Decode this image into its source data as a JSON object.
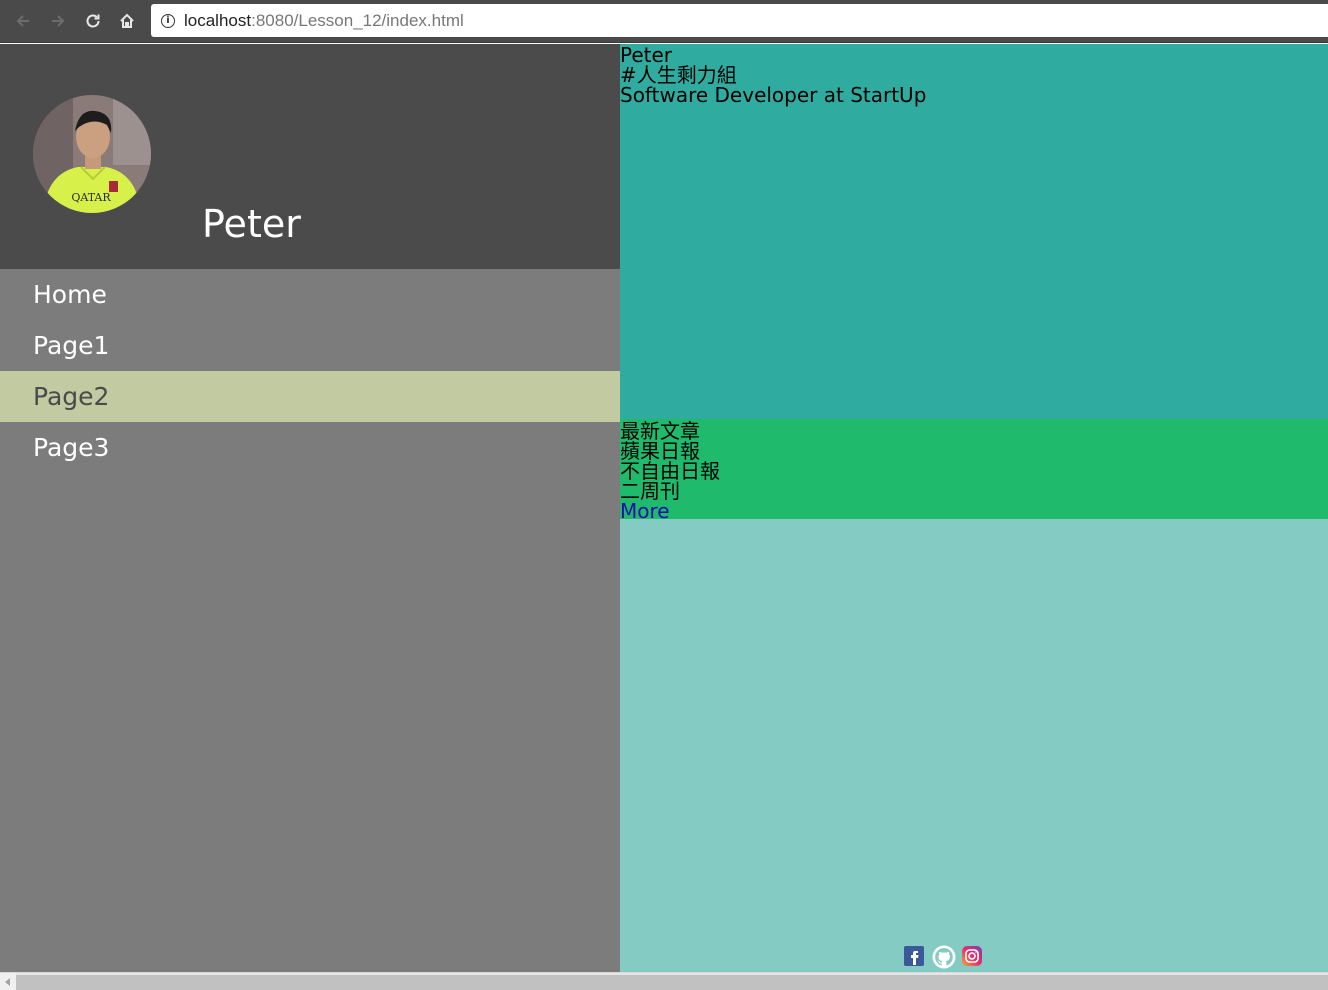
{
  "browser": {
    "url_host": "localhost",
    "url_path": ":8080/Lesson_12/index.html",
    "nav": {
      "back": "back-arrow",
      "forward": "forward-arrow",
      "reload": "reload",
      "home": "home"
    }
  },
  "sidebar": {
    "profile_name": "Peter",
    "menu": [
      {
        "label": "Home",
        "active": false
      },
      {
        "label": "Page1",
        "active": false
      },
      {
        "label": "Page2",
        "active": true
      },
      {
        "label": "Page3",
        "active": false
      }
    ]
  },
  "intro": {
    "name": "Peter",
    "tag": "#人生剩力組",
    "job": "Software Developer at StartUp"
  },
  "news": {
    "heading": "最新文章",
    "items": [
      "蘋果日報",
      "不自由日報",
      "二周刊"
    ],
    "more_link": "More"
  },
  "social": {
    "icons": [
      "facebook-icon",
      "github-icon",
      "instagram-icon"
    ]
  },
  "colors": {
    "sidebar_header": "#4b4b4b",
    "sidebar_bg": "#7c7c7c",
    "active_item": "#c2caa2",
    "intro_bg": "#2fac9f",
    "news_bg": "#1fba6c",
    "footer_bg": "#83cbc3"
  }
}
